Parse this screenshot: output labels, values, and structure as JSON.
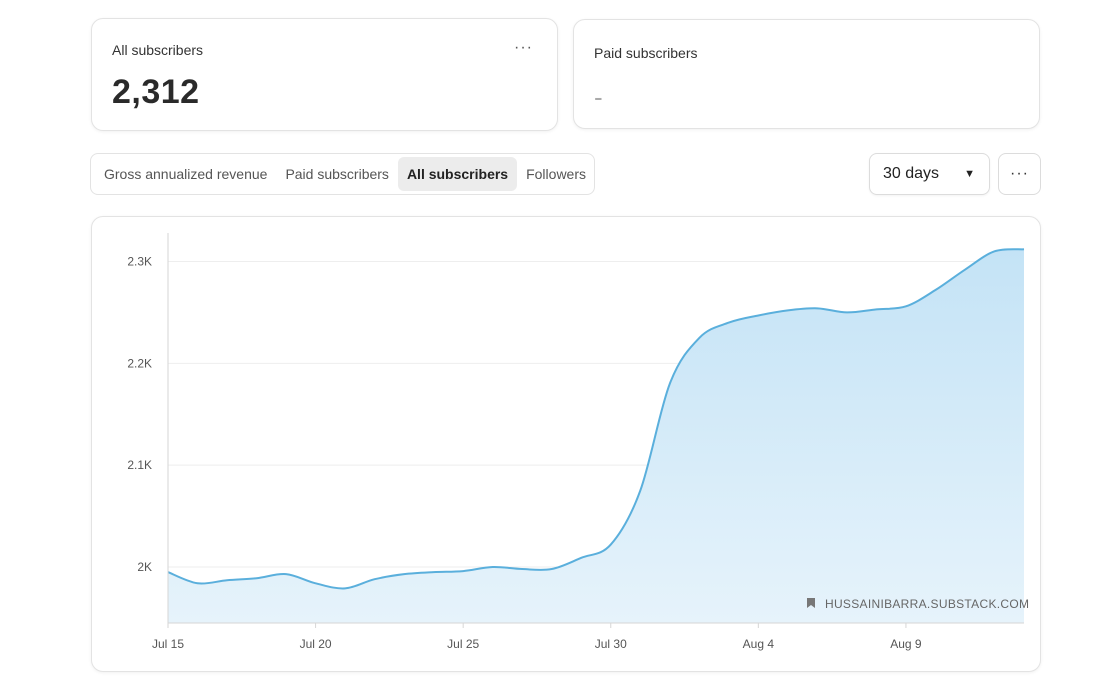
{
  "cards": {
    "all_subscribers": {
      "title": "All subscribers",
      "value": "2,312",
      "menu": "···"
    },
    "paid_subscribers": {
      "title": "Paid subscribers",
      "value": "-"
    }
  },
  "tabs": [
    {
      "label": "Gross annualized revenue",
      "active": false
    },
    {
      "label": "Paid subscribers",
      "active": false
    },
    {
      "label": "All subscribers",
      "active": true
    },
    {
      "label": "Followers",
      "active": false
    }
  ],
  "range_select": {
    "value": "30 days",
    "caret": "▼"
  },
  "chart_menu": "···",
  "colors": {
    "line": "#5aafdc",
    "fill_top": "#c4e3f6",
    "fill_bottom": "#e6f3fb",
    "grid": "#eeeeee"
  },
  "chart_data": {
    "type": "area",
    "title": "",
    "xlabel": "",
    "ylabel": "",
    "x_ticks": [
      "Jul 15",
      "Jul 20",
      "Jul 25",
      "Jul 30",
      "Aug 4",
      "Aug 9"
    ],
    "y_ticks": [
      "2K",
      "2.1K",
      "2.2K",
      "2.3K"
    ],
    "y_tick_values": [
      2000,
      2100,
      2200,
      2300
    ],
    "ylim": [
      1945,
      2328
    ],
    "xlim": [
      "Jul 15",
      "Aug 13"
    ],
    "grid": true,
    "watermark": "HUSSAINIBARRA.SUBSTACK.COM",
    "x": [
      "Jul 15",
      "Jul 16",
      "Jul 17",
      "Jul 18",
      "Jul 19",
      "Jul 20",
      "Jul 21",
      "Jul 22",
      "Jul 23",
      "Jul 24",
      "Jul 25",
      "Jul 26",
      "Jul 27",
      "Jul 28",
      "Jul 29",
      "Jul 30",
      "Jul 31",
      "Aug 1",
      "Aug 2",
      "Aug 3",
      "Aug 4",
      "Aug 5",
      "Aug 6",
      "Aug 7",
      "Aug 8",
      "Aug 9",
      "Aug 10",
      "Aug 11",
      "Aug 12",
      "Aug 13"
    ],
    "values": [
      1995,
      1984,
      1987,
      1989,
      1993,
      1984,
      1979,
      1988,
      1993,
      1995,
      1996,
      2000,
      1998,
      1998,
      2009,
      2022,
      2075,
      2180,
      2225,
      2240,
      2247,
      2252,
      2254,
      2250,
      2253,
      2256,
      2272,
      2292,
      2310,
      2312
    ]
  }
}
